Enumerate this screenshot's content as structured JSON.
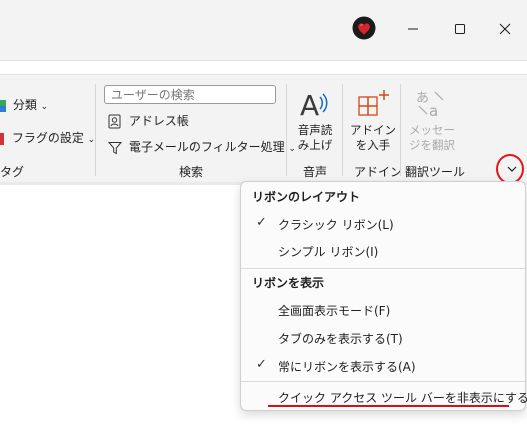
{
  "window": {
    "controls": {
      "minimize": "—",
      "maximize": "□",
      "close": "✕"
    }
  },
  "ribbon": {
    "left_fragment": {
      "categorize_label": "分類",
      "flag_label": "フラグの設定",
      "group_label": "タグ"
    },
    "search_group": {
      "search_placeholder": "ユーザーの検索",
      "address_book_label": "アドレス帳",
      "filter_email_label": "電子メールのフィルター処理",
      "group_label": "検索"
    },
    "speech_group": {
      "read_aloud_line1": "音声読",
      "read_aloud_line2": "み上げ",
      "group_label": "音声"
    },
    "addins_group": {
      "get_addins_line1": "アドイン",
      "get_addins_line2": "を入手",
      "group_label": "アドイン"
    },
    "translate_group": {
      "translate_line1": "メッセー",
      "translate_line2": "ジを翻訳",
      "group_label": "翻訳ツール"
    }
  },
  "menu": {
    "layout_header": "リボンのレイアウト",
    "layout_items": [
      {
        "label": "クラシック リボン(L)",
        "checked": true
      },
      {
        "label": "シンプル リボン(I)",
        "checked": false
      }
    ],
    "show_header": "リボンを表示",
    "show_items": [
      {
        "label": "全画面表示モード(F)",
        "checked": false
      },
      {
        "label": "タブのみを表示する(T)",
        "checked": false
      },
      {
        "label": "常にリボンを表示する(A)",
        "checked": true
      }
    ],
    "qat_item": {
      "label": "クイック アクセス ツール バーを非表示にする (H)"
    },
    "check_glyph": "✓"
  },
  "colors": {
    "highlight": "#e3161c",
    "underline": "#d80f14",
    "accent": "#0f6cbd"
  }
}
